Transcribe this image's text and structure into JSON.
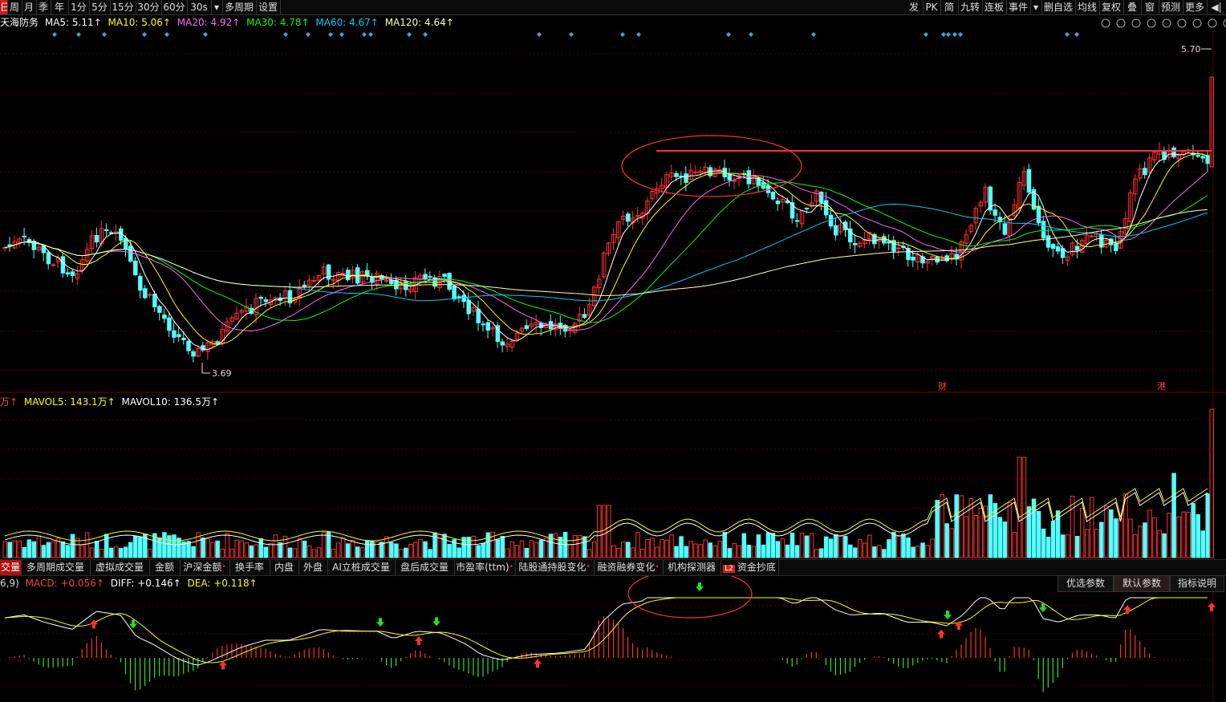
{
  "toolbar": {
    "left_items": [
      "日",
      "周",
      "月",
      "季",
      "年",
      "1分",
      "5分",
      "15分",
      "30分",
      "60分",
      "30s",
      "▾",
      "多周期",
      "设置"
    ],
    "right_items": [
      "发",
      "PK",
      "简",
      "九转",
      "连板",
      "事件",
      "▾",
      "删自选",
      "均线",
      "复权",
      "叠",
      "窗",
      "预测",
      "更多",
      "◀|"
    ]
  },
  "price_legend": {
    "stock_name": "天海防务",
    "ma5": "MA5: 5.11↑",
    "ma10": "MA10: 5.06↑",
    "ma20": "MA20: 4.92↑",
    "ma30": "MA30: 4.78↑",
    "ma60": "MA60: 4.67↑",
    "ma120": "MA120: 4.64↑"
  },
  "price_labels": {
    "high": "5.70",
    "low": "3.69",
    "marker_cai": "财",
    "marker_gang": "港"
  },
  "volume_legend": {
    "vol": "万↑",
    "mavol5": "MAVOL5: 143.1万↑",
    "mavol10": "MAVOL10: 136.5万↑"
  },
  "indicator_tabs": [
    {
      "label": "交量",
      "active": true
    },
    {
      "label": "多周期成交量"
    },
    {
      "label": "虚拟成交量"
    },
    {
      "label": "金额"
    },
    {
      "label": "沪深金额",
      "dot": true
    },
    {
      "label": "换手率"
    },
    {
      "label": "内盘"
    },
    {
      "label": "外盘"
    },
    {
      "label": "AI立桩成交量"
    },
    {
      "label": "盘后成交量"
    },
    {
      "label": "市盈率(ttm)",
      "dot": true
    },
    {
      "label": "陆股通持股变化",
      "dot": true
    },
    {
      "label": "融资融券变化",
      "dot": true
    },
    {
      "label": "机构探测器"
    },
    {
      "label": "资金抄底",
      "badge": "L2"
    }
  ],
  "macd_legend": {
    "params": "6,9)",
    "macd": "MACD: +0.056↑",
    "diff": "DIFF: +0.146↑",
    "dea": "DEA: +0.118↑"
  },
  "param_buttons": [
    "优选参数",
    "默认参数",
    "指标说明"
  ],
  "colors": {
    "up": "#ff3030",
    "down": "#54ffff",
    "ma5": "#ffffff",
    "ma10": "#ffff00",
    "ma20": "#ff66ff",
    "ma30": "#00ff00",
    "ma60": "#00ccff",
    "ma120": "#ffffaa",
    "diamond": "#3aa8e0"
  }
}
